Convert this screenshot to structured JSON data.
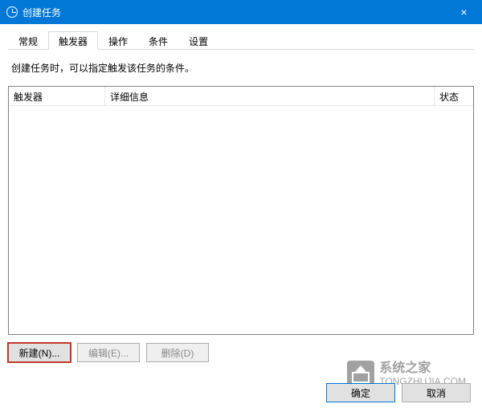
{
  "window": {
    "title": "创建任务",
    "close_label": "×"
  },
  "tabs": {
    "general": "常规",
    "triggers": "触发器",
    "actions": "操作",
    "conditions": "条件",
    "settings": "设置",
    "active": "triggers"
  },
  "description": "创建任务时，可以指定触发该任务的条件。",
  "table": {
    "columns": {
      "trigger": "触发器",
      "detail": "详细信息",
      "status": "状态"
    },
    "rows": []
  },
  "buttons": {
    "new": "新建(N)...",
    "edit": "编辑(E)...",
    "delete": "删除(D)"
  },
  "dialog_buttons": {
    "ok": "确定",
    "cancel": "取消"
  },
  "watermark": {
    "title": "系统之家",
    "sub": "TONGZHUJIA.COM"
  }
}
